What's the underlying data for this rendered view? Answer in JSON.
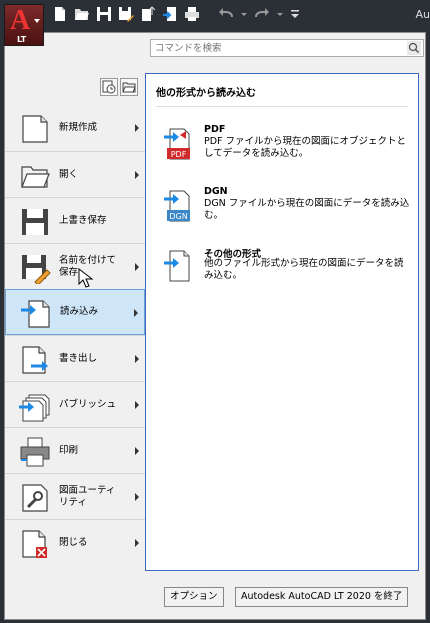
{
  "app": {
    "badge": "LT",
    "title_fragment": "Au"
  },
  "search": {
    "placeholder": "コマンドを検索"
  },
  "nav": [
    {
      "label": "新規作成",
      "icon": "new-document-icon",
      "has_submenu": true
    },
    {
      "label": "開く",
      "icon": "open-folder-icon",
      "has_submenu": true
    },
    {
      "label": "上書き保存",
      "icon": "save-icon",
      "has_submenu": false
    },
    {
      "label": "名前を付けて保存",
      "icon": "save-as-icon",
      "has_submenu": true
    },
    {
      "label": "読み込み",
      "icon": "import-icon",
      "has_submenu": true,
      "active": true
    },
    {
      "label": "書き出し",
      "icon": "export-icon",
      "has_submenu": true
    },
    {
      "label": "パブリッシュ",
      "icon": "publish-icon",
      "has_submenu": true
    },
    {
      "label": "印刷",
      "icon": "print-icon",
      "has_submenu": true
    },
    {
      "label": "図面ユーティリティ",
      "icon": "drawing-utilities-icon",
      "has_submenu": true
    },
    {
      "label": "閉じる",
      "icon": "close-document-icon",
      "has_submenu": true
    }
  ],
  "panel": {
    "title": "他の形式から読み込む",
    "entries": [
      {
        "title": "PDF",
        "description": "PDF ファイルから現在の図面にオブジェクトとしてデータを読み込む。",
        "icon": "pdf-import-icon",
        "badge": "PDF"
      },
      {
        "title": "DGN",
        "description": "DGN ファイルから現在の図面にデータを読み込む。",
        "icon": "dgn-import-icon",
        "badge": "DGN"
      },
      {
        "title": "その他の形式",
        "description": "他のファイル形式から現在の図面にデータを読み込む。",
        "icon": "other-format-import-icon"
      }
    ]
  },
  "footer": {
    "options_label": "オプション",
    "exit_label": "Autodesk AutoCAD LT 2020 を終了"
  },
  "colors": {
    "accent": "#3b6cc0",
    "active_bg": "#cfe5f8",
    "pdf_red": "#d02a2a",
    "dgn_blue": "#3a87c9",
    "arrow_blue": "#1e88e5"
  }
}
